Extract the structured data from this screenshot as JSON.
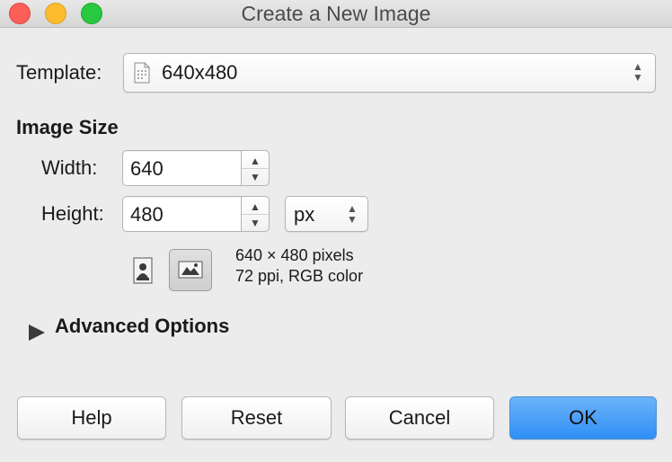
{
  "window": {
    "title": "Create a New Image"
  },
  "template": {
    "label": "Template:",
    "value": "640x480"
  },
  "image_size": {
    "heading": "Image Size",
    "width_label": "Width:",
    "width_value": "640",
    "height_label": "Height:",
    "height_value": "480",
    "unit": "px",
    "info_line1": "640 × 480 pixels",
    "info_line2": "72 ppi, RGB color"
  },
  "advanced": {
    "label": "Advanced Options"
  },
  "buttons": {
    "help": "Help",
    "reset": "Reset",
    "cancel": "Cancel",
    "ok": "OK"
  },
  "colors": {
    "ok_button": "#3b93f5",
    "close": "#fc5f57",
    "minimize": "#fdbb2e",
    "maximize": "#28c840"
  }
}
